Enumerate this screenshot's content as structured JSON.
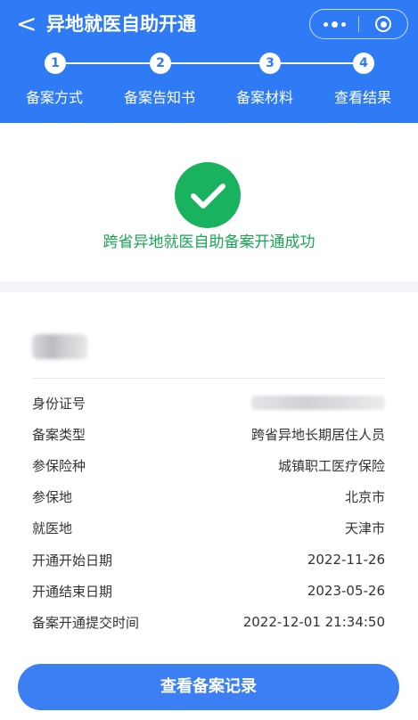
{
  "header": {
    "back_glyph": "<",
    "title": "异地就医自助开通",
    "more_icon": "more-dots-icon",
    "close_icon": "target-circle-icon",
    "background_color": "#2f7bf5"
  },
  "steps": [
    {
      "number": "1",
      "label": "备案方式"
    },
    {
      "number": "2",
      "label": "备案告知书"
    },
    {
      "number": "3",
      "label": "备案材料"
    },
    {
      "number": "4",
      "label": "查看结果"
    }
  ],
  "result": {
    "icon": "success-check-icon",
    "message": "跨省异地就医自助备案开通成功",
    "color": "#19b25e"
  },
  "details": {
    "name_redacted": true,
    "rows": [
      {
        "label": "身份证号",
        "value": "",
        "redacted": true
      },
      {
        "label": "备案类型",
        "value": "跨省异地长期居住人员"
      },
      {
        "label": "参保险种",
        "value": "城镇职工医疗保险"
      },
      {
        "label": "参保地",
        "value": "北京市"
      },
      {
        "label": "就医地",
        "value": "天津市"
      },
      {
        "label": "开通开始日期",
        "value": "2022-11-26"
      },
      {
        "label": "开通结束日期",
        "value": "2023-05-26"
      },
      {
        "label": "备案开通提交时间",
        "value": "2022-12-01 21:34:50"
      }
    ]
  },
  "action_button": {
    "label": "查看备案记录",
    "color": "#3b7ff2"
  }
}
